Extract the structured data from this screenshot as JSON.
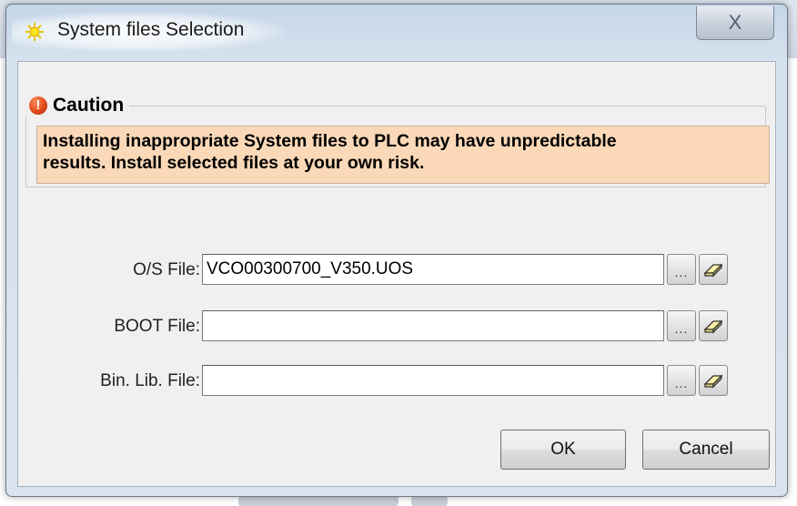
{
  "window": {
    "title": "System files Selection",
    "close_label": "X"
  },
  "caution": {
    "legend": "Caution",
    "icon_glyph": "!",
    "icon_color": "#e04a1a",
    "message_line1": "Installing inappropriate System files to PLC may have unpredictable",
    "message_line2": "results. Install selected files at your own risk.",
    "background_color": "#fbd9b8"
  },
  "files": [
    {
      "label": "O/S File:",
      "value": "VCO00300700_V350.UOS",
      "browse_label": "...",
      "clear_icon": "eraser-icon"
    },
    {
      "label": "BOOT File:",
      "value": "",
      "browse_label": "...",
      "clear_icon": "eraser-icon"
    },
    {
      "label": "Bin. Lib. File:",
      "value": "",
      "browse_label": "...",
      "clear_icon": "eraser-icon"
    }
  ],
  "buttons": {
    "ok": "OK",
    "cancel": "Cancel"
  }
}
